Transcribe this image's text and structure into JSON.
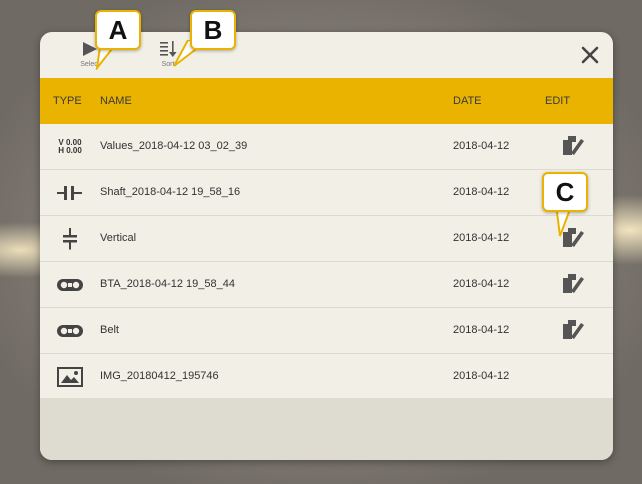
{
  "toolbar": {
    "select_label": "Select",
    "sort_label": "Sort",
    "close_icon": "close-icon"
  },
  "table": {
    "headers": {
      "type": "TYPE",
      "name": "NAME",
      "date": "DATE",
      "edit": "EDIT"
    },
    "rows": [
      {
        "type_icon": "values-icon",
        "type_text_v": "V 0.00",
        "type_text_h": "H 0.00",
        "name": "Values_2018-04-12 03_02_39",
        "date": "2018-04-12",
        "editable": true
      },
      {
        "type_icon": "shaft-icon",
        "name": "Shaft_2018-04-12 19_58_16",
        "date": "2018-04-12",
        "editable": true
      },
      {
        "type_icon": "vertical-icon",
        "name": "Vertical",
        "date": "2018-04-12",
        "editable": true
      },
      {
        "type_icon": "bta-icon",
        "name": "BTA_2018-04-12 19_58_44",
        "date": "2018-04-12",
        "editable": true
      },
      {
        "type_icon": "belt-icon",
        "name": "Belt",
        "date": "2018-04-12",
        "editable": true
      },
      {
        "type_icon": "image-icon",
        "name": "IMG_20180412_195746",
        "date": "2018-04-12",
        "editable": false
      }
    ]
  },
  "callouts": {
    "a": "A",
    "b": "B",
    "c": "C"
  },
  "colors": {
    "header": "#e9b300",
    "dialog": "#f1efe6",
    "callout_border": "#e9b300"
  }
}
